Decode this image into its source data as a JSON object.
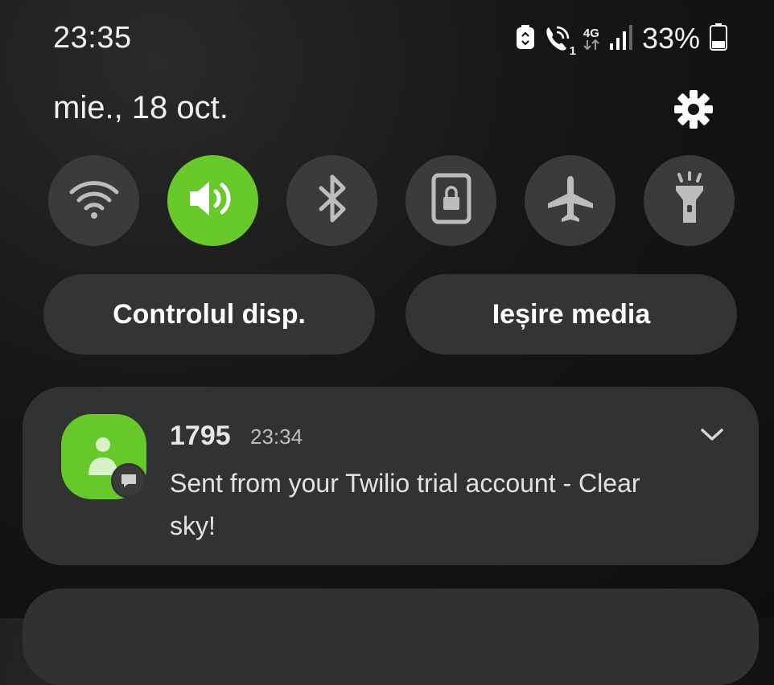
{
  "status_bar": {
    "time": "23:35",
    "network_type": "4G",
    "sim_slot": "1",
    "battery_percent": "33%",
    "icons": [
      "battery-saver-icon",
      "wifi-calling-icon",
      "network-4g-icon",
      "signal-icon",
      "battery-icon"
    ]
  },
  "header": {
    "date": "mie., 18 oct."
  },
  "quick_settings": {
    "tiles": [
      {
        "name": "wifi",
        "icon": "wifi-icon",
        "active": false
      },
      {
        "name": "sound",
        "icon": "volume-icon",
        "active": true
      },
      {
        "name": "bluetooth",
        "icon": "bluetooth-icon",
        "active": false
      },
      {
        "name": "lock",
        "icon": "lock-icon",
        "active": false
      },
      {
        "name": "airplane",
        "icon": "airplane-icon",
        "active": false
      },
      {
        "name": "flashlight",
        "icon": "flashlight-icon",
        "active": false
      }
    ],
    "accent_color": "#67c92a"
  },
  "buttons": {
    "device_control": "Controlul disp.",
    "media_output": "Ieșire media"
  },
  "notification": {
    "sender": "1795",
    "time": "23:34",
    "message": "Sent from your Twilio trial account - Clear sky!",
    "app_icon": "person-icon",
    "badge_icon": "message-bubble-icon"
  }
}
